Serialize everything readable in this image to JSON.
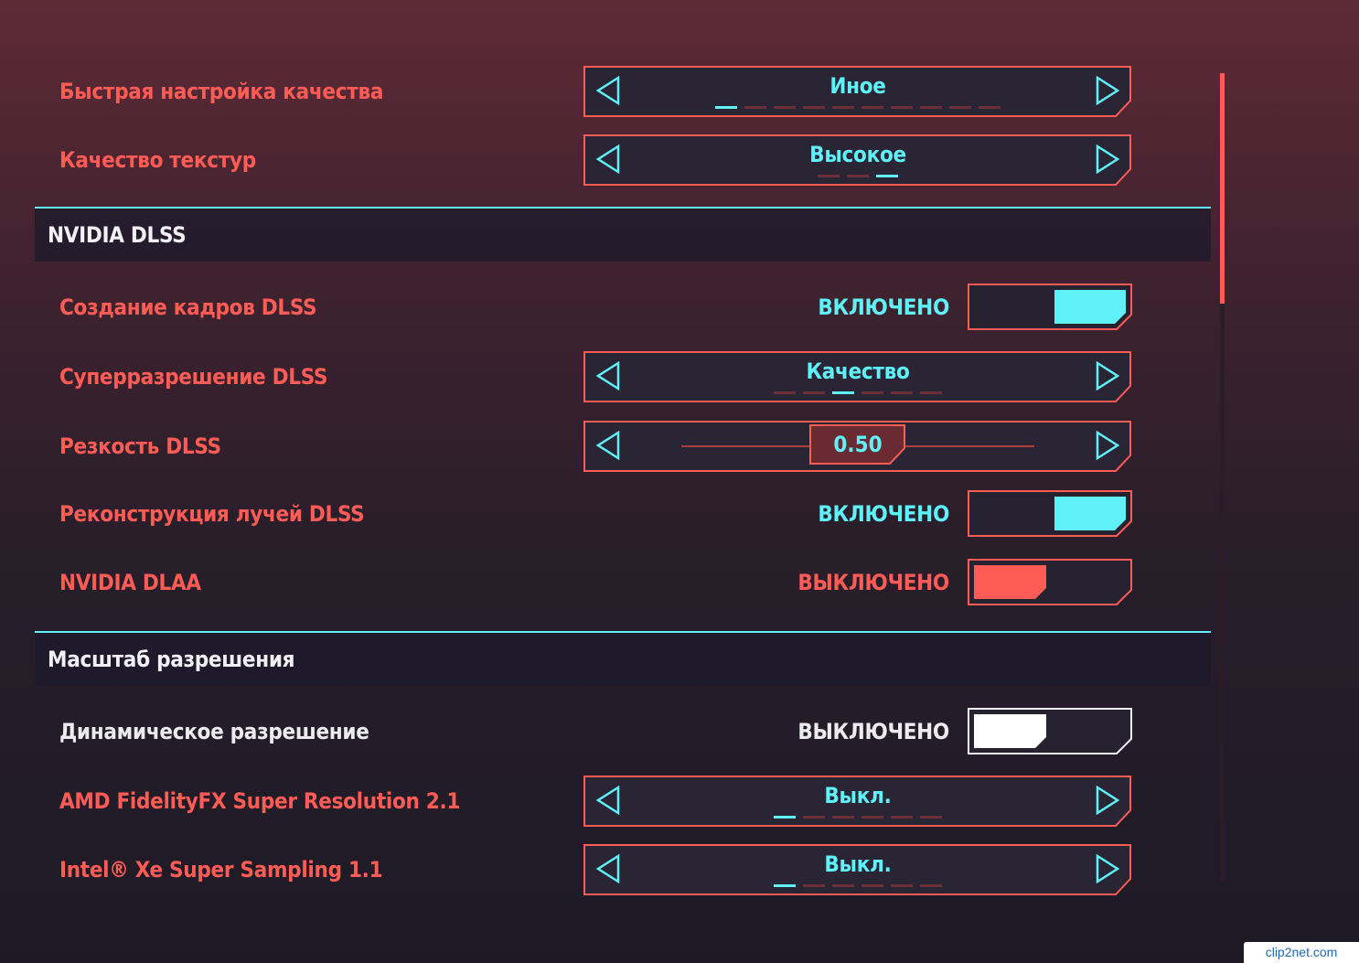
{
  "colors": {
    "accent_red": "#ff5c56",
    "accent_cyan": "#5ff1f7",
    "text_white": "#ecebef",
    "panel_bg": "#2a2534"
  },
  "settings_top": [
    {
      "label": "Быстрая настройка качества",
      "value": "Иное",
      "dash_count": 10,
      "active_index": 0
    },
    {
      "label": "Качество текстур",
      "value": "Высокое",
      "dash_count": 3,
      "active_index": 2
    }
  ],
  "section_dlss": {
    "title": "NVIDIA DLSS"
  },
  "dlss": {
    "frame_gen": {
      "label": "Создание кадров DLSS",
      "state": "ВКЛЮЧЕНО",
      "on": true
    },
    "super_res": {
      "label": "Суперразрешение DLSS",
      "value": "Качество",
      "dash_count": 6,
      "active_index": 2
    },
    "sharpness": {
      "label": "Резкость DLSS",
      "value": "0.50",
      "fraction": 0.5
    },
    "ray_recon": {
      "label": "Реконструкция лучей DLSS",
      "state": "ВКЛЮЧЕНО",
      "on": true
    },
    "dlaa": {
      "label": "NVIDIA DLAA",
      "state": "ВЫКЛЮЧЕНО",
      "on": false
    }
  },
  "section_scale": {
    "title": "Масштаб разрешения"
  },
  "scale": {
    "dynamic": {
      "label": "Динамическое разрешение",
      "state": "ВЫКЛЮЧЕНО",
      "on": false
    },
    "fsr": {
      "label": "AMD FidelityFX Super Resolution 2.1",
      "value": "Выкл.",
      "dash_count": 6,
      "active_index": 0
    },
    "xess": {
      "label": "Intel® Xe Super Sampling 1.1",
      "value": "Выкл.",
      "dash_count": 6,
      "active_index": 0
    }
  },
  "icons": {
    "left": "triangle-left-outline-icon",
    "right": "triangle-right-outline-icon"
  },
  "watermark": "clip2net.com"
}
